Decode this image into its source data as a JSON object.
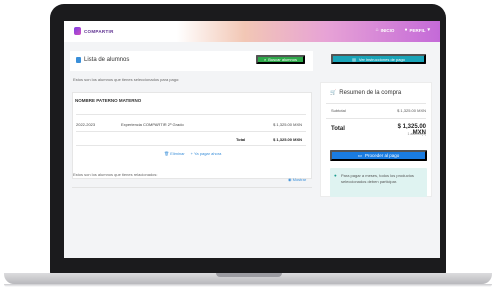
{
  "nav": {
    "brand": "COMPARTIR",
    "links": [
      {
        "label": "INICIO",
        "icon": "home-icon"
      },
      {
        "label": "PERFIL",
        "icon": "user-icon"
      }
    ],
    "colors": {
      "gradient_start": "#f2c7b5",
      "gradient_mid": "#e7a2d6",
      "gradient_end": "#c46ad8"
    }
  },
  "students": {
    "title": "Lista de alumnos",
    "search_button": "Buscar alumnos",
    "hint_selected": "Estos son los alumnos que tienes seleccionados para pago:",
    "card": {
      "name": "NOMBRE PATERNO MATERNO",
      "rows": [
        {
          "period": "2022-2023",
          "item": "Experiencia COMPARTIR 2º Grado",
          "amount": "$ 1,325.00 MXN"
        }
      ],
      "total_label": "Total",
      "total_amount": "$ 1,325.00 MXN",
      "actions": [
        "Eliminar",
        "Ya pagar ahora"
      ]
    },
    "hint_related": "Estos son los alumnos que tienes relacionados:",
    "show_link": "Mostrar"
  },
  "summary": {
    "instructions_button": "Ver instrucciones de pago",
    "title": "Resumen de la compra",
    "subtotal_label": "Subtotal",
    "subtotal_value": "$ 1,325.00 MXN",
    "total_label": "Total",
    "total_value": "$ 1,325.00 MXN",
    "total_units": "1 alumno(s)",
    "pay_button": "Proceder al pago",
    "info": "Para pagar a meses, todos los productos seleccionados deben participar."
  },
  "colors": {
    "green": "#2ea84a",
    "cyan": "#1aa4b8",
    "blue": "#1a7ce0",
    "info_bg": "#dff3f1"
  }
}
